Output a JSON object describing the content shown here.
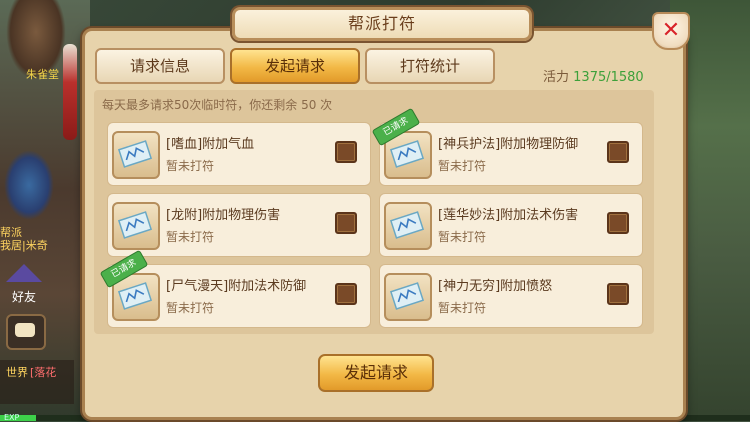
{
  "background": {
    "npc_name": "朱雀堂",
    "guild_lines": [
      "帮派",
      "我居|米奇"
    ],
    "friend_label": "好友",
    "world_channel": "世界",
    "world_message": "[落花",
    "exp_label": "EXP"
  },
  "panel": {
    "title": "帮派打符",
    "close_symbol": "✕"
  },
  "tabs": [
    {
      "label": "请求信息",
      "active": false
    },
    {
      "label": "发起请求",
      "active": true
    },
    {
      "label": "打符统计",
      "active": false
    }
  ],
  "vitality": {
    "label": "活力",
    "value": "1375/1580"
  },
  "tip": "每天最多请求50次临时符，你还剩余 50 次",
  "cards": [
    {
      "name": "[嗜血]附加气血",
      "status": "暂未打符",
      "stamp": ""
    },
    {
      "name": "[神兵护法]附加物理防御",
      "status": "暂未打符",
      "stamp": "已请求"
    },
    {
      "name": "[龙附]附加物理伤害",
      "status": "暂未打符",
      "stamp": ""
    },
    {
      "name": "[莲华妙法]附加法术伤害",
      "status": "暂未打符",
      "stamp": ""
    },
    {
      "name": "[尸气漫天]附加法术防御",
      "status": "暂未打符",
      "stamp": "已请求"
    },
    {
      "name": "[神力无穷]附加愤怒",
      "status": "暂未打符",
      "stamp": ""
    }
  ],
  "submit_label": "发起请求",
  "colors": {
    "panel_bg": "#e7d3ab",
    "tab_active": "#f2b845",
    "vitality_value": "#3da03a",
    "stamp": "#4bb04a",
    "close": "#d8242a"
  }
}
